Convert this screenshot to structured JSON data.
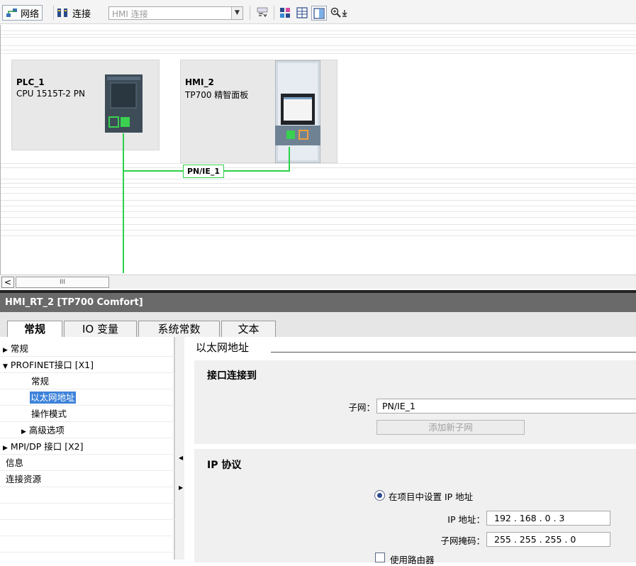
{
  "toolbar": {
    "network_label": "网络",
    "connect_label": "连接",
    "connection_type": "HMI 连接"
  },
  "devices": [
    {
      "name": "PLC_1",
      "type": "CPU 1515T-2 PN"
    },
    {
      "name": "HMI_2",
      "type": "TP700 精智面板"
    }
  ],
  "subnet_label": "PN/IE_1",
  "scrollbar": {
    "thumb_grip": "III",
    "left_arrow": "<"
  },
  "inspector": {
    "title": "HMI_RT_2 [TP700 Comfort]",
    "tabs": [
      "常规",
      "IO 变量",
      "系统常数",
      "文本"
    ]
  },
  "tree": [
    {
      "label": "常规",
      "arrow": "▶"
    },
    {
      "label": "PROFINET接口 [X1]",
      "arrow": "▼"
    },
    {
      "label": "常规",
      "arrow": ""
    },
    {
      "label": "以太网地址",
      "arrow": ""
    },
    {
      "label": "操作模式",
      "arrow": ""
    },
    {
      "label": "高级选项",
      "arrow": "▶"
    },
    {
      "label": "MPI/DP 接口 [X2]",
      "arrow": "▶"
    },
    {
      "label": "信息",
      "arrow": ""
    },
    {
      "label": "连接资源",
      "arrow": ""
    }
  ],
  "props": {
    "section_title": "以太网地址",
    "iface_title": "接口连接到",
    "subnet_label": "子网：",
    "subnet_value": "PN/IE_1",
    "add_subnet": "添加新子网",
    "ip_title": "IP 协议",
    "radio_label": "在项目中设置 IP 地址",
    "ip_label": "IP 地址：",
    "ip_value": "192 . 168 . 0    . 3",
    "mask_label": "子网掩码：",
    "mask_value": "255 . 255 . 255 . 0",
    "router_label": "使用路由器"
  }
}
